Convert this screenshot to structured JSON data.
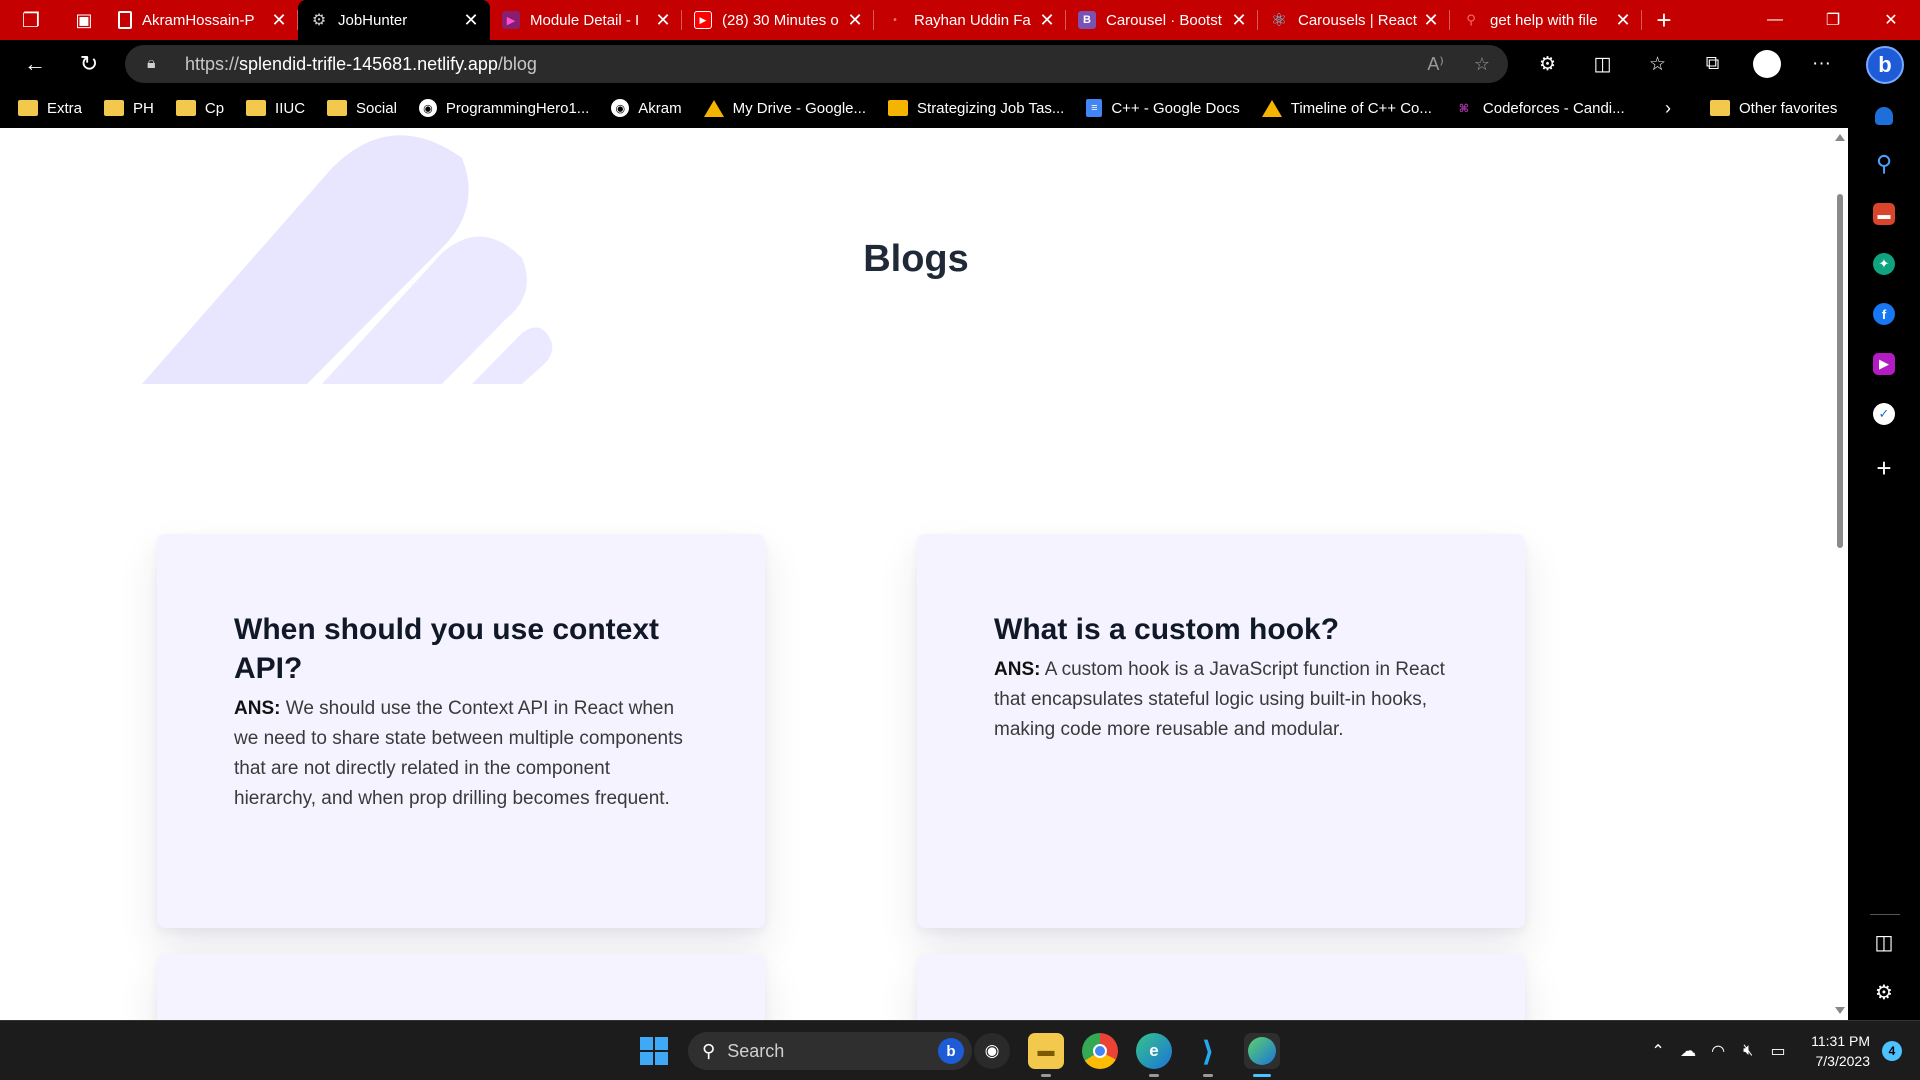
{
  "browser": {
    "tabs": [
      {
        "title": "AkramHossain-P",
        "favicon": "document-icon",
        "active": false
      },
      {
        "title": "JobHunter",
        "favicon": "robot-icon",
        "active": true
      },
      {
        "title": "Module Detail - I",
        "favicon": "ph-icon",
        "active": false
      },
      {
        "title": "(28) 30 Minutes o",
        "favicon": "youtube-icon",
        "active": false
      },
      {
        "title": "Rayhan Uddin Fa",
        "favicon": "loading-icon",
        "active": false
      },
      {
        "title": "Carousel · Bootst",
        "favicon": "bootstrap-icon",
        "active": false
      },
      {
        "title": "Carousels | React",
        "favicon": "react-icon",
        "active": false
      },
      {
        "title": "get help with file",
        "favicon": "search-icon",
        "active": false
      }
    ],
    "url_prefix": "https://",
    "url_host": "splendid-trifle-145681.netlify.app",
    "url_path": "/blog",
    "favorites": [
      {
        "label": "Extra",
        "icon": "folder"
      },
      {
        "label": "PH",
        "icon": "folder"
      },
      {
        "label": "Cp",
        "icon": "folder"
      },
      {
        "label": "IIUC",
        "icon": "folder"
      },
      {
        "label": "Social",
        "icon": "folder"
      },
      {
        "label": "ProgrammingHero1...",
        "icon": "github"
      },
      {
        "label": "Akram",
        "icon": "github"
      },
      {
        "label": "My Drive - Google...",
        "icon": "gdrive"
      },
      {
        "label": "Strategizing Job Tas...",
        "icon": "gslide"
      },
      {
        "label": "C++ - Google Docs",
        "icon": "gdoc"
      },
      {
        "label": "Timeline of C++ Co...",
        "icon": "gdrive"
      },
      {
        "label": "Codeforces - Candi...",
        "icon": "codeforces"
      }
    ],
    "other_favorites": "Other favorites"
  },
  "page": {
    "title": "Blogs",
    "ans_label": "ANS:",
    "cards": [
      {
        "question": "When should you use context API?",
        "answer": "We should use the Context API in React when we need to share state between multiple components that are not directly related in the component hierarchy, and when prop drilling becomes frequent."
      },
      {
        "question": "What is a custom hook?",
        "answer": "A custom hook is a JavaScript function in React that encapsulates stateful logic using built-in hooks, making code more reusable and modular."
      }
    ]
  },
  "taskbar": {
    "search_placeholder": "Search",
    "time": "11:31 PM",
    "date": "7/3/2023",
    "notifications": "4"
  },
  "colors": {
    "tab_strip": "#c40000",
    "card_bg": "#f4f3ff",
    "decor": "#e8e6ff"
  }
}
